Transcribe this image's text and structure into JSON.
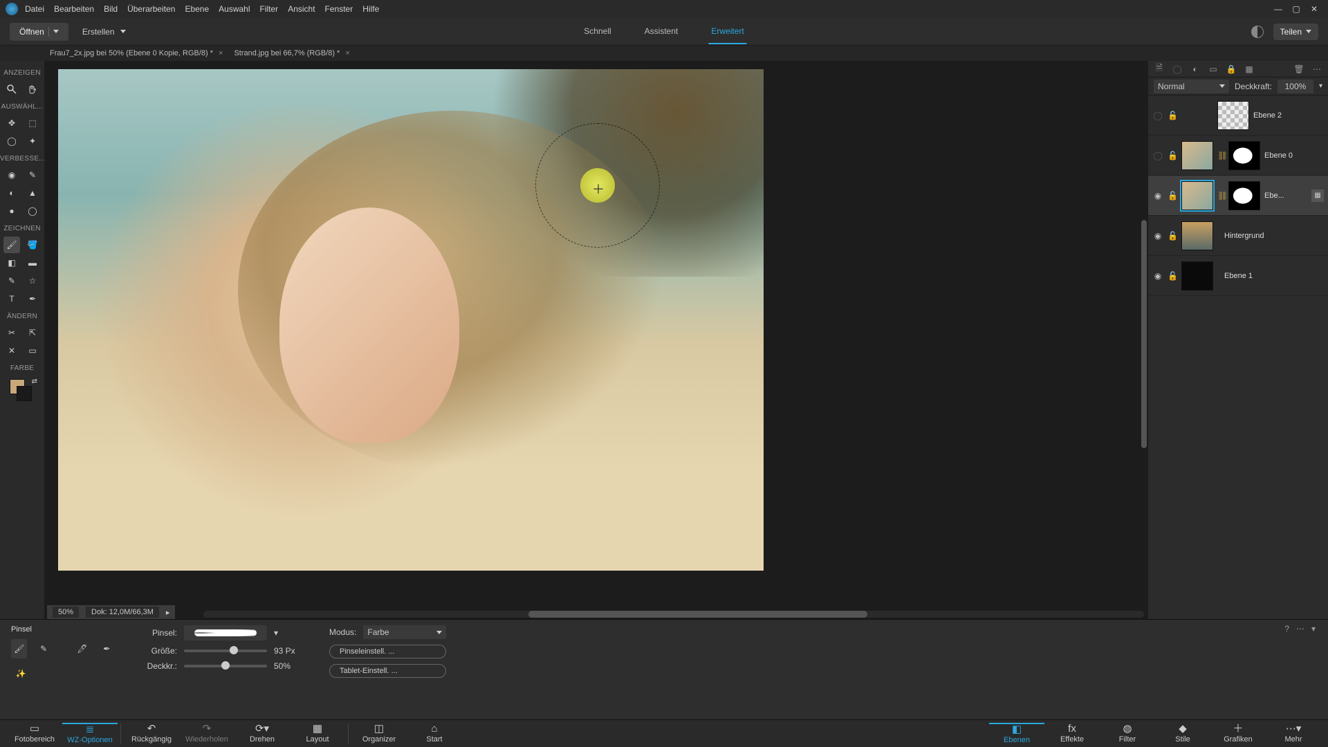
{
  "menu": {
    "items": [
      "Datei",
      "Bearbeiten",
      "Bild",
      "Überarbeiten",
      "Ebene",
      "Auswahl",
      "Filter",
      "Ansicht",
      "Fenster",
      "Hilfe"
    ]
  },
  "topbar": {
    "open": "Öffnen",
    "create": "Erstellen",
    "share": "Teilen",
    "modes": [
      "Schnell",
      "Assistent",
      "Erweitert"
    ],
    "active_mode": "Erweitert"
  },
  "doctabs": [
    {
      "title": "Frau7_2x.jpg bei 50% (Ebene 0 Kopie, RGB/8) *"
    },
    {
      "title": "Strand.jpg bei 66,7% (RGB/8) *"
    }
  ],
  "toolbox": {
    "sections": {
      "anzeigen": "ANZEIGEN",
      "auswahl": "AUSWÄHL...",
      "verbessern": "VERBESSE...",
      "zeichnen": "ZEICHNEN",
      "aendern": "ÄNDERN",
      "farbe": "FARBE"
    }
  },
  "status": {
    "zoom": "50%",
    "doc": "Dok: 12,0M/66,3M"
  },
  "layerspanel": {
    "blendmode": "Normal",
    "opacity_label": "Deckkraft:",
    "opacity": "100%",
    "layers": [
      {
        "name": "Ebene 2",
        "visible": false,
        "thumb": "checker"
      },
      {
        "name": "Ebene 0",
        "visible": false,
        "thumb": "photo",
        "mask": true
      },
      {
        "name": "Ebe...",
        "visible": true,
        "thumb": "photo",
        "mask": true,
        "selected": true,
        "fx": true
      },
      {
        "name": "Hintergrund",
        "visible": true,
        "thumb": "bg"
      },
      {
        "name": "Ebene 1",
        "visible": true,
        "thumb": "black"
      }
    ]
  },
  "tooloptions": {
    "title": "Pinsel",
    "brush_label": "Pinsel:",
    "size_label": "Größe:",
    "size_value": "93 Px",
    "size_pct": 55,
    "opacity_label": "Deckkr.:",
    "opacity_value": "50%",
    "opacity_pct": 45,
    "mode_label": "Modus:",
    "mode_value": "Farbe",
    "btn_brush": "Pinseleinstell. ...",
    "btn_tablet": "Tablet-Einstell. ..."
  },
  "bottombar_left": [
    {
      "k": "fotobereich",
      "label": "Fotobereich",
      "icon": "▭"
    },
    {
      "k": "wzoptionen",
      "label": "WZ-Optionen",
      "icon": "≣",
      "active": true
    },
    {
      "k": "rueckgaengig",
      "label": "Rückgängig",
      "icon": "↶"
    },
    {
      "k": "wiederholen",
      "label": "Wiederholen",
      "icon": "↷"
    },
    {
      "k": "drehen",
      "label": "Drehen",
      "icon": "⟳"
    },
    {
      "k": "layout",
      "label": "Layout",
      "icon": "▦"
    },
    {
      "k": "organizer",
      "label": "Organizer",
      "icon": "◫"
    },
    {
      "k": "start",
      "label": "Start",
      "icon": "⌂"
    }
  ],
  "bottombar_right": [
    {
      "k": "ebenen",
      "label": "Ebenen",
      "icon": "◧",
      "active": true
    },
    {
      "k": "effekte",
      "label": "Effekte",
      "icon": "fx"
    },
    {
      "k": "filter",
      "label": "Filter",
      "icon": "◍"
    },
    {
      "k": "stile",
      "label": "Stile",
      "icon": "◆"
    },
    {
      "k": "grafiken",
      "label": "Grafiken",
      "icon": "＋"
    },
    {
      "k": "mehr",
      "label": "Mehr",
      "icon": "⋯"
    }
  ]
}
